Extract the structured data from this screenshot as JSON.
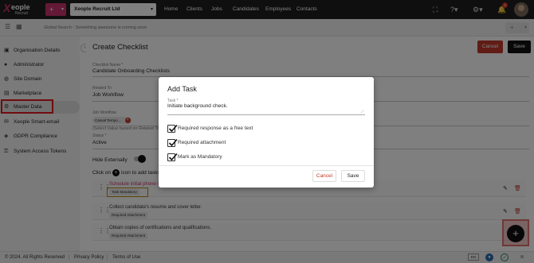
{
  "topbar": {
    "logo_x": "X",
    "logo_word": "eople",
    "logo_sub": "Recruit",
    "add_label": "+",
    "caret": "▾",
    "company": "Xeople Recruit Ltd",
    "nav": [
      "Home",
      "Clients",
      "Jobs",
      "Candidates",
      "Employees",
      "Contacts"
    ],
    "notification_count": "4"
  },
  "search": {
    "placeholder": "Global Search - Something awesome is coming soon",
    "add_label": "+"
  },
  "sidebar": {
    "items": [
      {
        "label": "Organisation Details"
      },
      {
        "label": "Administrator"
      },
      {
        "label": "Site Domain"
      },
      {
        "label": "Marketplace"
      },
      {
        "label": "Master Data"
      },
      {
        "label": "Xeople Smart-email"
      },
      {
        "label": "GDPR Compliance"
      },
      {
        "label": "System Access Tokens"
      }
    ]
  },
  "page": {
    "title": "Create Checklist",
    "cancel": "Cancel",
    "save": "Save"
  },
  "form": {
    "checklist_name_label": "Checklist Name *",
    "checklist_name_value": "Candidate Onboarding Checklists",
    "related_to_label": "Related To",
    "related_to_value": "Job Workflow",
    "job_workflow_label": "Job Workflow",
    "job_workflow_chip": "Casual Tempo ...",
    "select_hint": "(Select Value based on Related To)",
    "status_label": "Status *",
    "status_value": "Active",
    "hide_externally": "Hide Externally",
    "click_on": "Click on",
    "add_task_hint": "icon to add tasks"
  },
  "tasks": [
    {
      "title": "Schedule initial phone screening",
      "badge": "Task Mandatory"
    },
    {
      "title": "Collect candidate's resume and cover letter.",
      "badge": "Required Attachment"
    },
    {
      "title": "Obtain copies of certifications and qualifications.",
      "badge": "Required Attachment"
    }
  ],
  "modal": {
    "title": "Add Task",
    "task_label": "Task *",
    "task_value": "Initiate background check.",
    "options": [
      {
        "label": "Required response as a free text",
        "checked": true
      },
      {
        "label": "Required attachment",
        "checked": true
      },
      {
        "label": "Mark as Mandatory",
        "checked": true
      }
    ],
    "cancel": "Cancel",
    "save": "Save"
  },
  "footer": {
    "copyright": "© 2024. All Rights Reserved",
    "privacy": "Privacy Policy",
    "terms": "Terms of Use",
    "separator": "|",
    "lang": "EN"
  },
  "colors": {
    "brand": "#c8326b",
    "topbar": "#1f1f1f",
    "danger": "#c0392b",
    "highlight": "#e0191e"
  }
}
